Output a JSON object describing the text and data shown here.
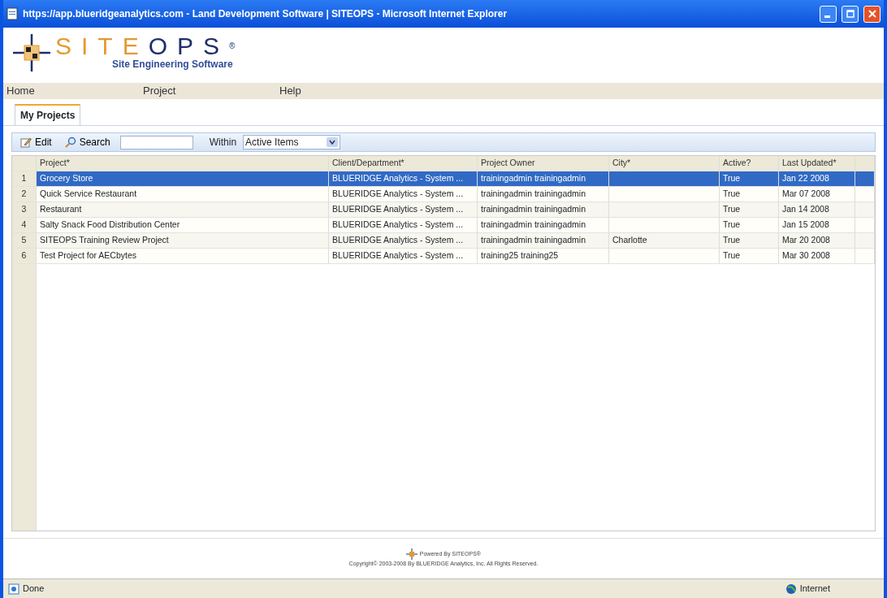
{
  "window": {
    "title": "https://app.blueridgeanalytics.com - Land Development Software | SITEOPS - Microsoft Internet Explorer"
  },
  "logo": {
    "word_first": "SITE",
    "word_second": "OPS",
    "registered": "®",
    "tagline": "Site Engineering Software"
  },
  "menu": [
    "Home",
    "Project",
    "Help"
  ],
  "tabs": [
    {
      "label": "My Projects",
      "selected": true
    }
  ],
  "toolbar": {
    "edit": "Edit",
    "search": "Search",
    "within_label": "Within",
    "within_value": "Active Items"
  },
  "table": {
    "columns": [
      "Project*",
      "Client/Department*",
      "Project Owner",
      "City*",
      "Active?",
      "Last Updated*"
    ],
    "rows": [
      {
        "number": "1",
        "selected": true,
        "cells": [
          "Grocery Store",
          "BLUERIDGE Analytics - System ...",
          "trainingadmin trainingadmin",
          "",
          "True",
          "Jan 22 2008"
        ]
      },
      {
        "number": "2",
        "selected": false,
        "cells": [
          "Quick Service Restaurant",
          "BLUERIDGE Analytics - System ...",
          "trainingadmin trainingadmin",
          "",
          "True",
          "Mar 07 2008"
        ]
      },
      {
        "number": "3",
        "selected": false,
        "cells": [
          "Restaurant",
          "BLUERIDGE Analytics - System ...",
          "trainingadmin trainingadmin",
          "",
          "True",
          "Jan 14 2008"
        ]
      },
      {
        "number": "4",
        "selected": false,
        "cells": [
          "Salty Snack Food Distribution Center",
          "BLUERIDGE Analytics - System ...",
          "trainingadmin trainingadmin",
          "",
          "True",
          "Jan 15 2008"
        ]
      },
      {
        "number": "5",
        "selected": false,
        "cells": [
          "SITEOPS Training Review Project",
          "BLUERIDGE Analytics - System ...",
          "trainingadmin trainingadmin",
          "Charlotte",
          "True",
          "Mar 20 2008"
        ]
      },
      {
        "number": "6",
        "selected": false,
        "cells": [
          "Test Project for AECbytes",
          "BLUERIDGE Analytics - System ...",
          "training25 training25",
          "",
          "True",
          "Mar 30 2008"
        ]
      }
    ]
  },
  "footer": {
    "powered": "Powered By SITEOPS®",
    "copyright": "Copyright© 2003-2008 By BLUERIDGE Analytics, Inc. All Rights Reserved."
  },
  "status_bar": {
    "status": "Done",
    "zone": "Internet"
  }
}
